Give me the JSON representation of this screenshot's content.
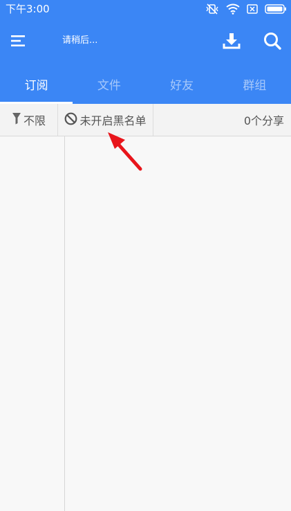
{
  "status_bar": {
    "time": "下午3:00",
    "icons": [
      "vibrate-off-icon",
      "wifi-icon",
      "sim-card-icon",
      "battery-icon"
    ]
  },
  "toolbar": {
    "title": "请稍后...",
    "icons": [
      "menu-icon",
      "download-icon",
      "search-icon"
    ]
  },
  "tabs": [
    {
      "label": "订阅",
      "active": true
    },
    {
      "label": "文件",
      "active": false
    },
    {
      "label": "好友",
      "active": false
    },
    {
      "label": "群组",
      "active": false
    }
  ],
  "filter_bar": {
    "range_label": "不限",
    "range_icon": "filter-funnel-icon",
    "blacklist_label": "未开启黑名单",
    "blacklist_icon": "prohibited-icon",
    "share_count": "0个分享"
  },
  "colors": {
    "accent": "#3b86f5",
    "annotation_arrow": "#e8151b"
  }
}
